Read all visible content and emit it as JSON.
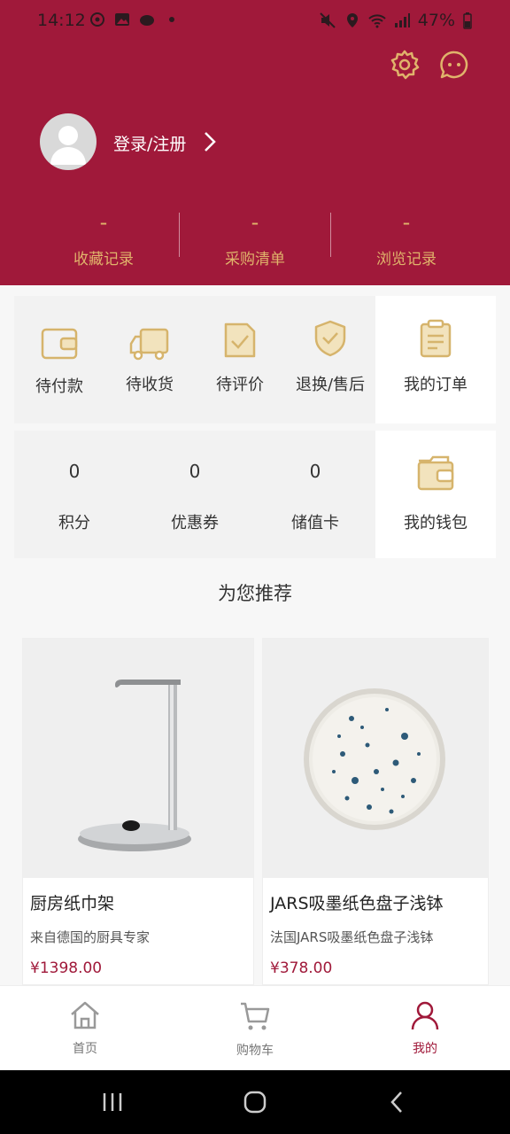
{
  "status_bar": {
    "time": "14:12",
    "battery": "47%"
  },
  "header": {
    "login_label": "登录/注册",
    "stats": [
      {
        "value": "-",
        "label": "收藏记录"
      },
      {
        "value": "-",
        "label": "采购清单"
      },
      {
        "value": "-",
        "label": "浏览记录"
      }
    ]
  },
  "orders": {
    "items": [
      {
        "label": "待付款",
        "icon": "wallet-icon"
      },
      {
        "label": "待收货",
        "icon": "truck-icon"
      },
      {
        "label": "待评价",
        "icon": "review-icon"
      },
      {
        "label": "退换/售后",
        "icon": "shield-icon"
      }
    ],
    "my_orders": "我的订单"
  },
  "assets": {
    "items": [
      {
        "value": "0",
        "label": "积分"
      },
      {
        "value": "0",
        "label": "优惠券"
      },
      {
        "value": "0",
        "label": "储值卡"
      }
    ],
    "my_wallet": "我的钱包"
  },
  "recommend": {
    "title": "为您推荐",
    "products": [
      {
        "name": "厨房纸巾架",
        "desc": "来自德国的厨具专家",
        "price": "¥1398.00"
      },
      {
        "name": "JARS吸墨纸色盘子浅钵",
        "desc": "法国JARS吸墨纸色盘子浅钵",
        "price": "¥378.00"
      }
    ]
  },
  "tabs": [
    {
      "label": "首页",
      "icon": "home-icon"
    },
    {
      "label": "购物车",
      "icon": "cart-icon"
    },
    {
      "label": "我的",
      "icon": "user-icon",
      "active": true
    }
  ],
  "colors": {
    "brand": "#a0193a",
    "gold": "#e0b36b"
  }
}
